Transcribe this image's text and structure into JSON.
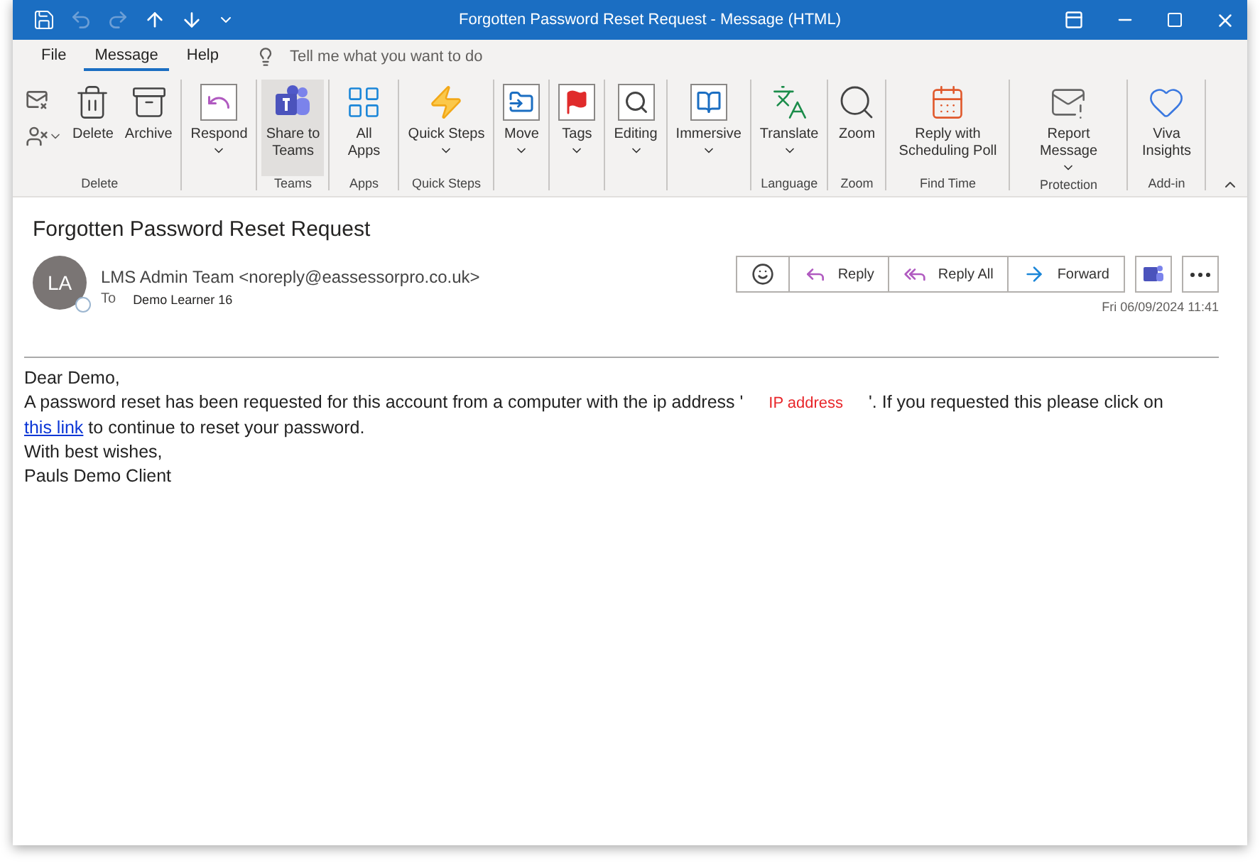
{
  "window": {
    "title": "Forgotten Password Reset Request  -  Message (HTML)"
  },
  "menu_tabs": [
    {
      "label": "File",
      "selected": false
    },
    {
      "label": "Message",
      "selected": true
    },
    {
      "label": "Help",
      "selected": false
    }
  ],
  "tell_me": {
    "placeholder": "Tell me what you want to do"
  },
  "ribbon_groups": [
    {
      "label": "Delete",
      "items": [
        {
          "label": "Delete",
          "dropdown": false,
          "highlighted": false
        },
        {
          "label": "Archive",
          "dropdown": false,
          "highlighted": false
        }
      ]
    },
    {
      "items": [
        {
          "label": "Respond",
          "dropdown": true,
          "highlighted": false
        }
      ]
    },
    {
      "label": "Teams",
      "items": [
        {
          "label": "Share to Teams",
          "dropdown": false,
          "highlighted": true
        }
      ]
    },
    {
      "label": "Apps",
      "items": [
        {
          "label": "All Apps",
          "dropdown": false,
          "highlighted": false
        }
      ]
    },
    {
      "label": "Quick Steps",
      "items": [
        {
          "label": "Quick Steps",
          "dropdown": true,
          "highlighted": false
        }
      ]
    },
    {
      "items": [
        {
          "label": "Move",
          "dropdown": true,
          "highlighted": false
        }
      ]
    },
    {
      "items": [
        {
          "label": "Tags",
          "dropdown": true,
          "highlighted": false
        }
      ]
    },
    {
      "items": [
        {
          "label": "Editing",
          "dropdown": true,
          "highlighted": false
        }
      ]
    },
    {
      "items": [
        {
          "label": "Immersive",
          "dropdown": true,
          "highlighted": false
        }
      ]
    },
    {
      "label": "Language",
      "items": [
        {
          "label": "Translate",
          "dropdown": true,
          "highlighted": false
        }
      ]
    },
    {
      "label": "Zoom",
      "items": [
        {
          "label": "Zoom",
          "dropdown": false,
          "highlighted": false
        }
      ]
    },
    {
      "label": "Find Time",
      "items": [
        {
          "label": "Reply with Scheduling Poll",
          "dropdown": false,
          "highlighted": false
        }
      ]
    },
    {
      "label": "Protection",
      "items": [
        {
          "label": "Report Message",
          "dropdown": true,
          "highlighted": false
        }
      ]
    },
    {
      "label": "Add-in",
      "items": [
        {
          "label": "Viva Insights",
          "dropdown": false,
          "highlighted": false
        }
      ]
    }
  ],
  "message": {
    "subject": "Forgotten Password Reset Request",
    "avatar_initials": "LA",
    "sender": "LMS Admin Team <noreply@eassessorpro.co.uk>",
    "to_label": "To",
    "recipient": "Demo Learner 16",
    "actions": [
      {
        "label": "Reply"
      },
      {
        "label": "Reply All"
      },
      {
        "label": "Forward"
      }
    ],
    "date": "Fri 06/09/2024 11:41"
  },
  "body": {
    "greeting": "Dear Demo,",
    "text_before": "A password reset has been requested for this account from a computer with the ip address '",
    "ip_placeholder": "IP address",
    "text_after": "'. If you requested this please click on",
    "link": "this link",
    "text_end": "to continue to reset your password.",
    "signoff": "With best wishes,",
    "signature": "Pauls Demo Client"
  }
}
